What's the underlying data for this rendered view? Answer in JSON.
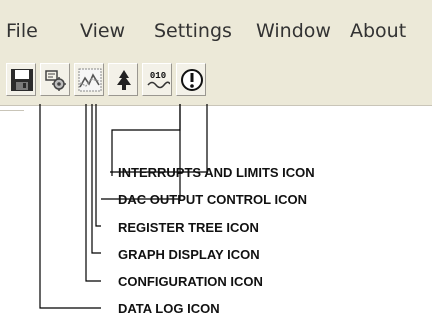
{
  "menu": {
    "file": "File",
    "view": "View",
    "settings": "Settings",
    "window": "Window",
    "about": "About"
  },
  "toolbar": {
    "buttons": [
      {
        "icon": "floppy-disk-icon"
      },
      {
        "icon": "configuration-icon"
      },
      {
        "icon": "graph-display-icon"
      },
      {
        "icon": "register-tree-icon"
      },
      {
        "icon": "dac-output-icon",
        "text": "010"
      },
      {
        "icon": "exclamation-circle-icon"
      }
    ]
  },
  "callouts": {
    "interrupts": "INTERRUPTS AND LIMITS ICON",
    "dac": "DAC OUTPUT CONTROL ICON",
    "register": "REGISTER TREE ICON",
    "graph": "GRAPH DISPLAY ICON",
    "config": "CONFIGURATION ICON",
    "datalog": "DATA LOG ICON"
  }
}
